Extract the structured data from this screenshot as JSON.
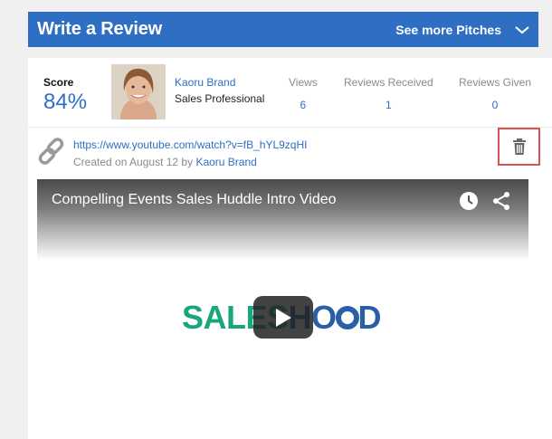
{
  "header": {
    "title": "Write a Review",
    "link_label": "See more Pitches",
    "bg_color": "#2e6fc4"
  },
  "score": {
    "label": "Score",
    "value": "84%"
  },
  "profile": {
    "name": "Kaoru Brand",
    "title": "Sales Professional"
  },
  "stats": [
    {
      "label": "Views",
      "value": "6"
    },
    {
      "label": "Reviews Received",
      "value": "1"
    },
    {
      "label": "Reviews Given",
      "value": "0"
    }
  ],
  "pitch": {
    "url": "https://www.youtube.com/watch?v=fB_hYL9zqHI",
    "created_prefix": "Created on August 12 by",
    "author": "Kaoru Brand"
  },
  "video": {
    "title": "Compelling Events Sales Huddle Intro Video",
    "logo_part1": "SALES",
    "logo_part2": "HO",
    "logo_part3": "D"
  },
  "icons": {
    "link": "link-icon",
    "trash": "trash-icon",
    "chevron": "chevron-down-icon",
    "clock": "clock-icon",
    "share": "share-icon",
    "play": "play-icon"
  }
}
